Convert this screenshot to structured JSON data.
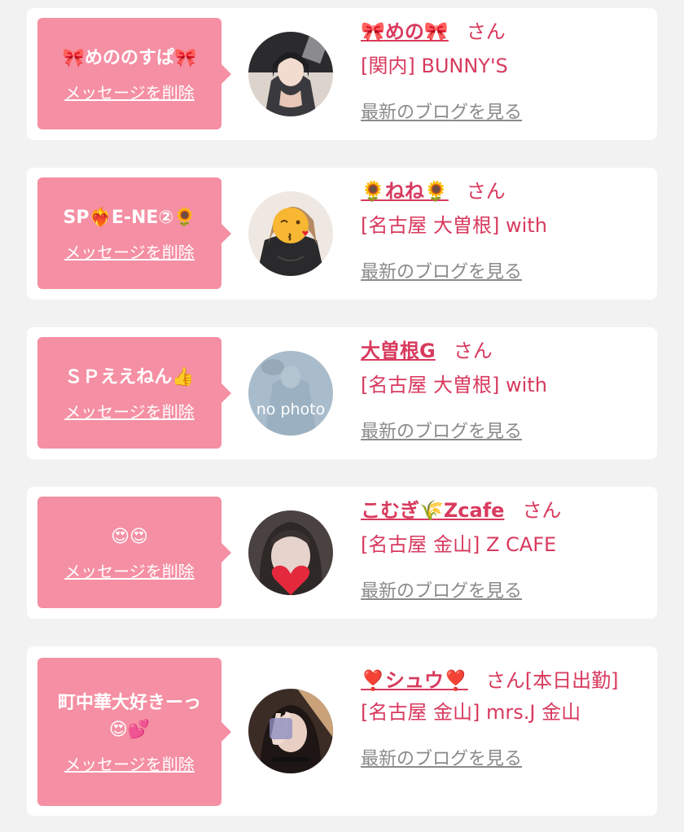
{
  "delete_label": "メッセージを削除",
  "san_label": "さん",
  "blog_label": "最新のブログを見る",
  "colors": {
    "bubble": "#f58fa3",
    "accent": "#d83a5e",
    "link_gray": "#8a8a8a",
    "background": "#f2f2f2"
  },
  "entries": [
    {
      "message": "🎀めののすぱ🎀",
      "name": "🎀めの🎀",
      "san": "さん",
      "shop": "[関内] BUNNY'S",
      "avatar_icon": "girl-photo-avatar"
    },
    {
      "message": "SP❤️‍🔥E-NE②🌻",
      "name": "🌻ねね🌻",
      "san": "さん",
      "shop": "[名古屋 大曽根] with",
      "avatar_icon": "kiss-emoji-avatar"
    },
    {
      "message": "ＳＰええねん👍",
      "name": "大曽根G",
      "san": "さん",
      "shop": "[名古屋 大曽根] with",
      "avatar_icon": "no-photo-avatar",
      "avatar_text": "no photo"
    },
    {
      "message": "😍😍",
      "name": "こむぎ🌾Zcafe",
      "san": "さん",
      "shop": "[名古屋 金山] Z CAFE",
      "avatar_icon": "heart-photo-avatar"
    },
    {
      "message": "町中華大好きーっ😍💕",
      "name": "❣️シュウ❣️",
      "san": "さん[本日出勤]",
      "shop": "[名古屋 金山] mrs.J 金山",
      "avatar_icon": "peace-sign-photo-avatar"
    }
  ]
}
